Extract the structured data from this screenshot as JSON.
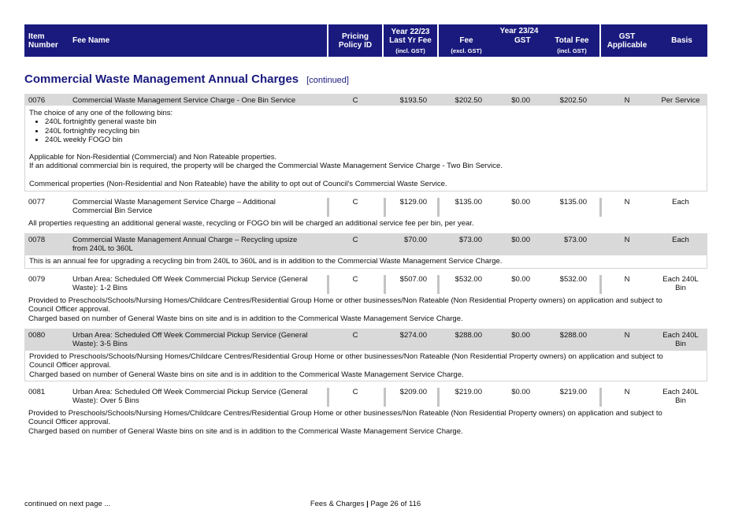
{
  "header": {
    "item_number": [
      "Item",
      "Number"
    ],
    "fee_name": "Fee Name",
    "pricing_policy": [
      "Pricing",
      "Policy ID"
    ],
    "year_prev": "Year 22/23",
    "last_yr_fee": "Last Yr Fee",
    "incl_gst": "(incl. GST)",
    "year_curr": "Year 23/24",
    "fee": "Fee",
    "excl_gst": "(excl. GST)",
    "gst": "GST",
    "total_fee": "Total Fee",
    "total_incl_gst": "(incl. GST)",
    "gst_applicable": [
      "GST",
      "Applicable"
    ],
    "basis": "Basis"
  },
  "section": {
    "title": "Commercial Waste Management Annual Charges",
    "continued": "[continued]"
  },
  "rows": [
    {
      "item": "0076",
      "name": [
        "Commercial Waste Management Service Charge - One Bin Service"
      ],
      "policy": "C",
      "last_yr": "$193.50",
      "fee": "$202.50",
      "gst": "$0.00",
      "total": "$202.50",
      "gst_app": "N",
      "basis": [
        "Per Service"
      ]
    },
    {
      "item": "0077",
      "name": [
        "Commercial Waste Management Service Charge – Additional",
        "Commercial Bin Service"
      ],
      "policy": "C",
      "last_yr": "$129.00",
      "fee": "$135.00",
      "gst": "$0.00",
      "total": "$135.00",
      "gst_app": "N",
      "basis": [
        "Each"
      ]
    },
    {
      "item": "0078",
      "name": [
        "Commercial Waste Management Annual Charge – Recycling upsize",
        "from 240L to 360L"
      ],
      "policy": "C",
      "last_yr": "$70.00",
      "fee": "$73.00",
      "gst": "$0.00",
      "total": "$73.00",
      "gst_app": "N",
      "basis": [
        "Each"
      ]
    },
    {
      "item": "0079",
      "name": [
        "Urban Area: Scheduled Off Week Commercial Pickup Service (General",
        "Waste): 1-2 Bins"
      ],
      "policy": "C",
      "last_yr": "$507.00",
      "fee": "$532.00",
      "gst": "$0.00",
      "total": "$532.00",
      "gst_app": "N",
      "basis": [
        "Each 240L",
        "Bin"
      ]
    },
    {
      "item": "0080",
      "name": [
        "Urban Area: Scheduled Off Week Commercial Pickup Service (General",
        "Waste): 3-5 Bins"
      ],
      "policy": "C",
      "last_yr": "$274.00",
      "fee": "$288.00",
      "gst": "$0.00",
      "total": "$288.00",
      "gst_app": "N",
      "basis": [
        "Each 240L",
        "Bin"
      ]
    },
    {
      "item": "0081",
      "name": [
        "Urban Area: Scheduled Off Week Commercial Pickup Service (General",
        "Waste): Over 5 Bins"
      ],
      "policy": "C",
      "last_yr": "$209.00",
      "fee": "$219.00",
      "gst": "$0.00",
      "total": "$219.00",
      "gst_app": "N",
      "basis": [
        "Each 240L",
        "Bin"
      ]
    }
  ],
  "descriptions": {
    "d0076": {
      "intro": "The choice of any one of the following bins:",
      "bullets": [
        "240L fortnightly general waste bin",
        "240L fortnightly recycling bin",
        "240L weekly FOGO bin"
      ],
      "p1": "Applicable for Non-Residential (Commercial) and Non Rateable properties.",
      "p2": "If an additional commercial bin is required, the property will be charged the Commercial Waste Management Service Charge - Two Bin Service.",
      "p3": "Commerical properties (Non-Residential and Non Rateable) have the ability to opt out of Council's Commercial Waste Service."
    },
    "d0077": "All properties requesting an additional general waste, recycling or FOGO bin will be charged an additional service fee per bin, per year.",
    "d0078": "This is an annual fee for upgrading a recycling bin from 240L to 360L and is in addition to the Commercial Waste Management Service Charge.",
    "d0079": [
      "Provided to Preschools/Schools/Nursing Homes/Childcare Centres/Residential Group Home or other businesses/Non Rateable (Non Residential Property owners) on application and subject to",
      "Council Officer approval.",
      "Charged based on number of General Waste bins on site and is in addition to the Commerical Waste Management Service Charge."
    ],
    "d0080": [
      "Provided to Preschools/Schools/Nursing Homes/Childcare Centres/Residential Group Home or other businesses/Non Rateable (Non Residential Property owners) on application and subject to",
      "Council Officer approval.",
      "Charged based on number of General Waste bins on site and is in addition to the Commerical Waste Management Service Charge."
    ],
    "d0081": [
      "Provided to Preschools/Schools/Nursing Homes/Childcare Centres/Residential Group Home or other businesses/Non Rateable (Non Residential Property owners) on application and subject to",
      "Council Officer approval.",
      "Charged based on number of General Waste bins on site and is in addition to the Commerical Waste Management Service Charge."
    ]
  },
  "footer": {
    "continued": "continued on next page ...",
    "page_prefix": "Fees & Charges",
    "page_sep": "|",
    "page_info": "Page 26 of 116"
  },
  "colors": {
    "header_bg": "#1a1a7e",
    "title": "#1a1a7e",
    "row_shade": "#d9d9d9"
  }
}
